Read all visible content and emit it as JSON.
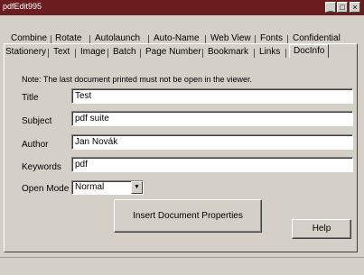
{
  "window": {
    "title": "pdfEdit995",
    "controls": {
      "minimize": "_",
      "maximize": "□",
      "close": "×"
    }
  },
  "tabs_row1": [
    "Combine",
    "Rotate",
    "Autolaunch",
    "Auto-Name",
    "Web View",
    "Fonts",
    "Confidential"
  ],
  "tabs_row2": [
    "Stationery",
    "Text",
    "Image",
    "Batch",
    "Page Number",
    "Bookmark",
    "Links",
    "DocInfo"
  ],
  "active_tab": "DocInfo",
  "docinfo": {
    "note": "Note: The last document printed must not be open in the viewer.",
    "title_label": "Title",
    "title_value": "Test",
    "subject_label": "Subject",
    "subject_value": "pdf suite",
    "author_label": "Author",
    "author_value": "Jan Novák",
    "keywords_label": "Keywords",
    "keywords_value": "pdf",
    "open_mode_label": "Open Mode",
    "open_mode_value": "Normal",
    "insert_button": "Insert Document Properties",
    "help_button": "Help"
  }
}
